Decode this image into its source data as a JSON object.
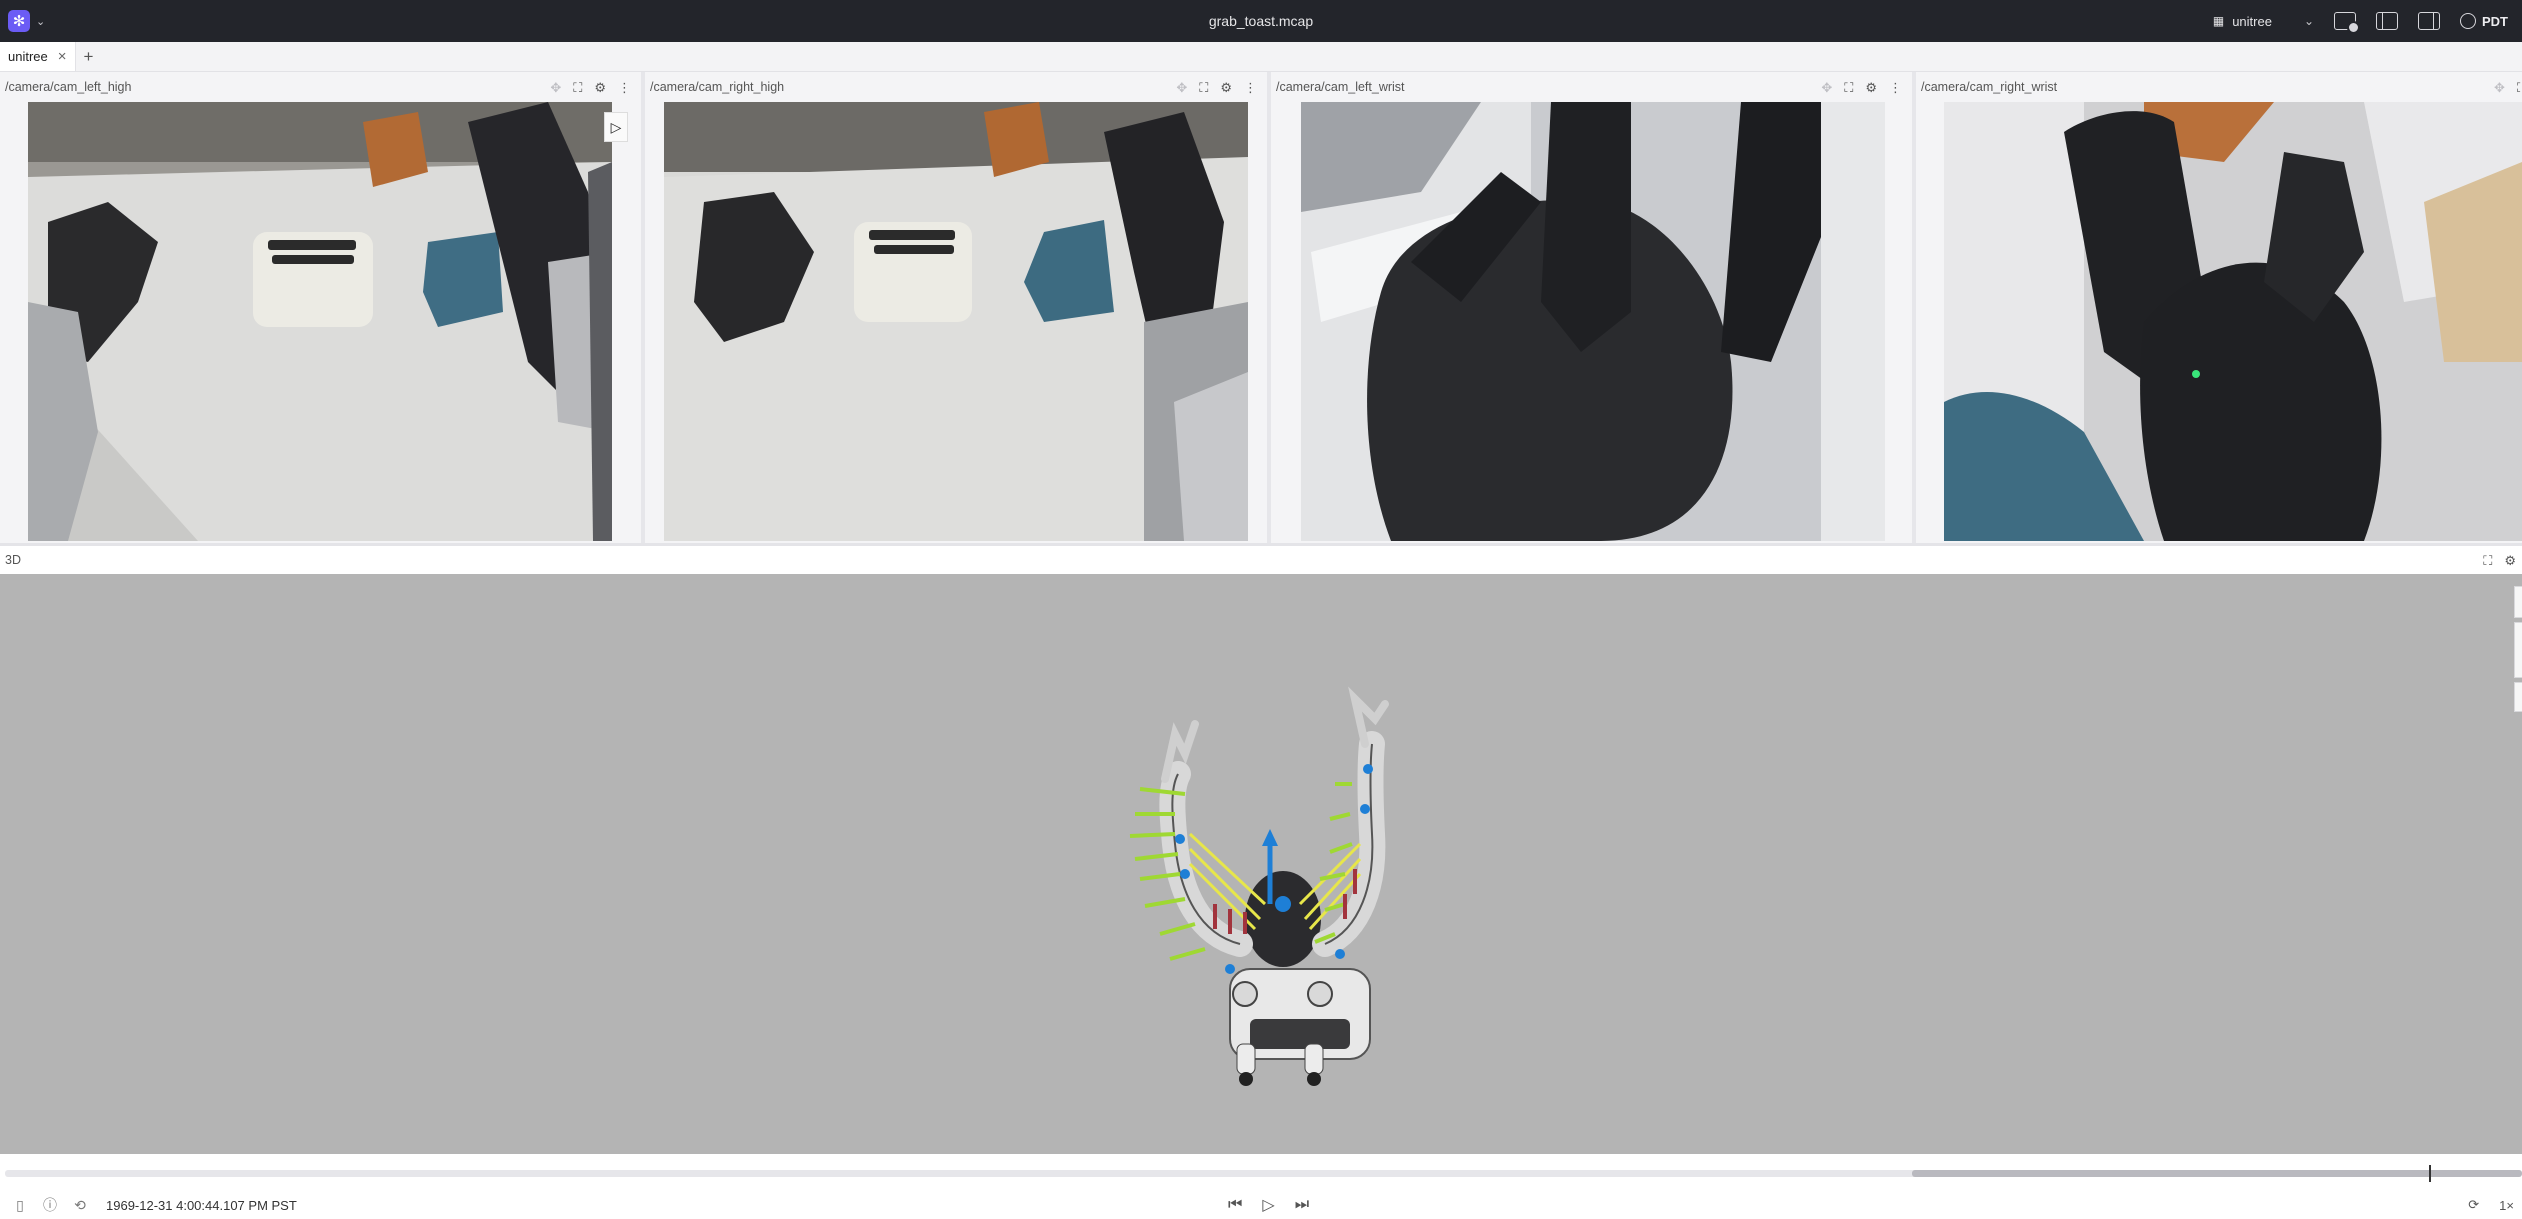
{
  "app": {
    "logo_icon": "foxglove-logo-icon",
    "file_title": "grab_toast.mcap",
    "layout_name": "unitree",
    "timezone": "PDT",
    "accent_color": "#6b5cf5"
  },
  "tabs": [
    {
      "label": "unitree",
      "active": true
    }
  ],
  "tab_add_label": "+",
  "panels": [
    {
      "topic": "/camera/cam_left_high"
    },
    {
      "topic": "/camera/cam_right_high"
    },
    {
      "topic": "/camera/cam_left_wrist"
    },
    {
      "topic": "/camera/cam_right_wrist"
    }
  ],
  "panel3d": {
    "title": "3D"
  },
  "playback": {
    "timestamp": "1969-12-31 4:00:44.107 PM PST",
    "speed": "1×",
    "loaded_range": [
      0.7575,
      1.0
    ],
    "position": 0.963
  }
}
